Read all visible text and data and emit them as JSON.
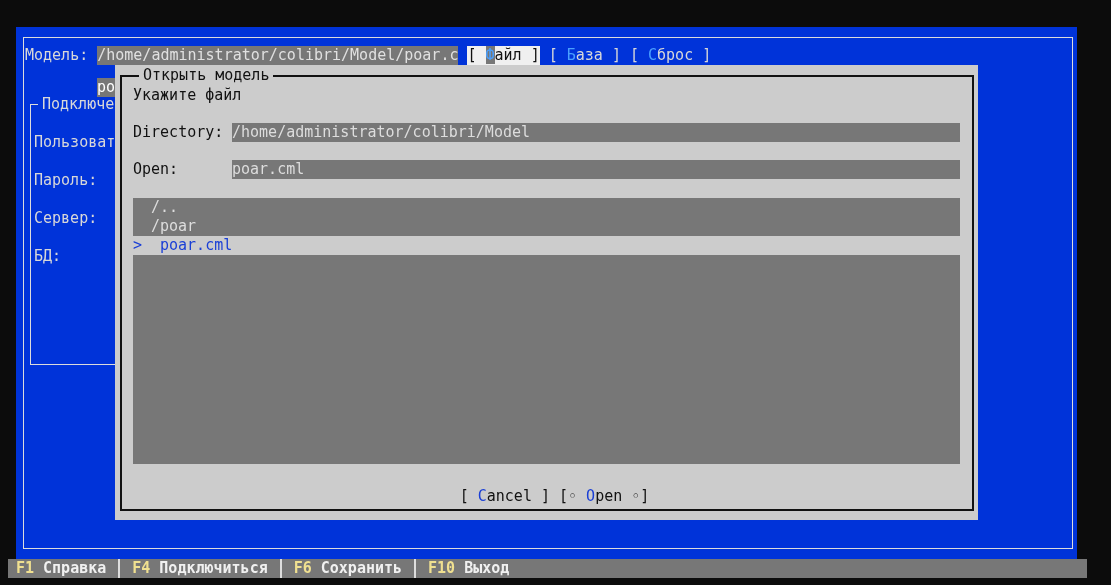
{
  "main": {
    "model_label": "Модель:",
    "model_path": "/home/administrator/colibri/Model/poar.c",
    "buttons": [
      {
        "left": "[",
        "hotkey": "Ф",
        "rest": "айл",
        "right": "]",
        "focused": true
      },
      {
        "left": "[",
        "hotkey": "Б",
        "rest": "аза",
        "right": "]",
        "focused": false
      },
      {
        "left": "[",
        "hotkey": "С",
        "rest": "брос",
        "right": "]",
        "focused": false
      }
    ],
    "second_field": "ро",
    "connection": {
      "title": "Подключе",
      "labels": [
        "Пользоват",
        "Пароль:",
        "Сервер:",
        "БД:"
      ]
    }
  },
  "dialog": {
    "title": "Открыть модель",
    "prompt": "Укажите файл",
    "directory_label": "Directory:",
    "directory": "/home/administrator/colibri/Model",
    "open_label": "Open:",
    "open_value": "poar.cml",
    "cursor": ">",
    "files": [
      {
        "name": "/..",
        "selected": false
      },
      {
        "name": "/poar",
        "selected": false
      },
      {
        "name": "poar.cml",
        "selected": true
      }
    ],
    "buttons": [
      {
        "left": "[",
        "hotkey": "C",
        "rest": "ancel",
        "right": "]"
      },
      {
        "left": "[◦",
        "hotkey": "O",
        "rest": "pen",
        "right": "◦]"
      }
    ]
  },
  "status_bar": [
    {
      "key": "F1",
      "label": "Справка"
    },
    {
      "key": "F4",
      "label": "Подключиться"
    },
    {
      "key": "F6",
      "label": "Сохранить"
    },
    {
      "key": "F10",
      "label": "Выход"
    }
  ]
}
